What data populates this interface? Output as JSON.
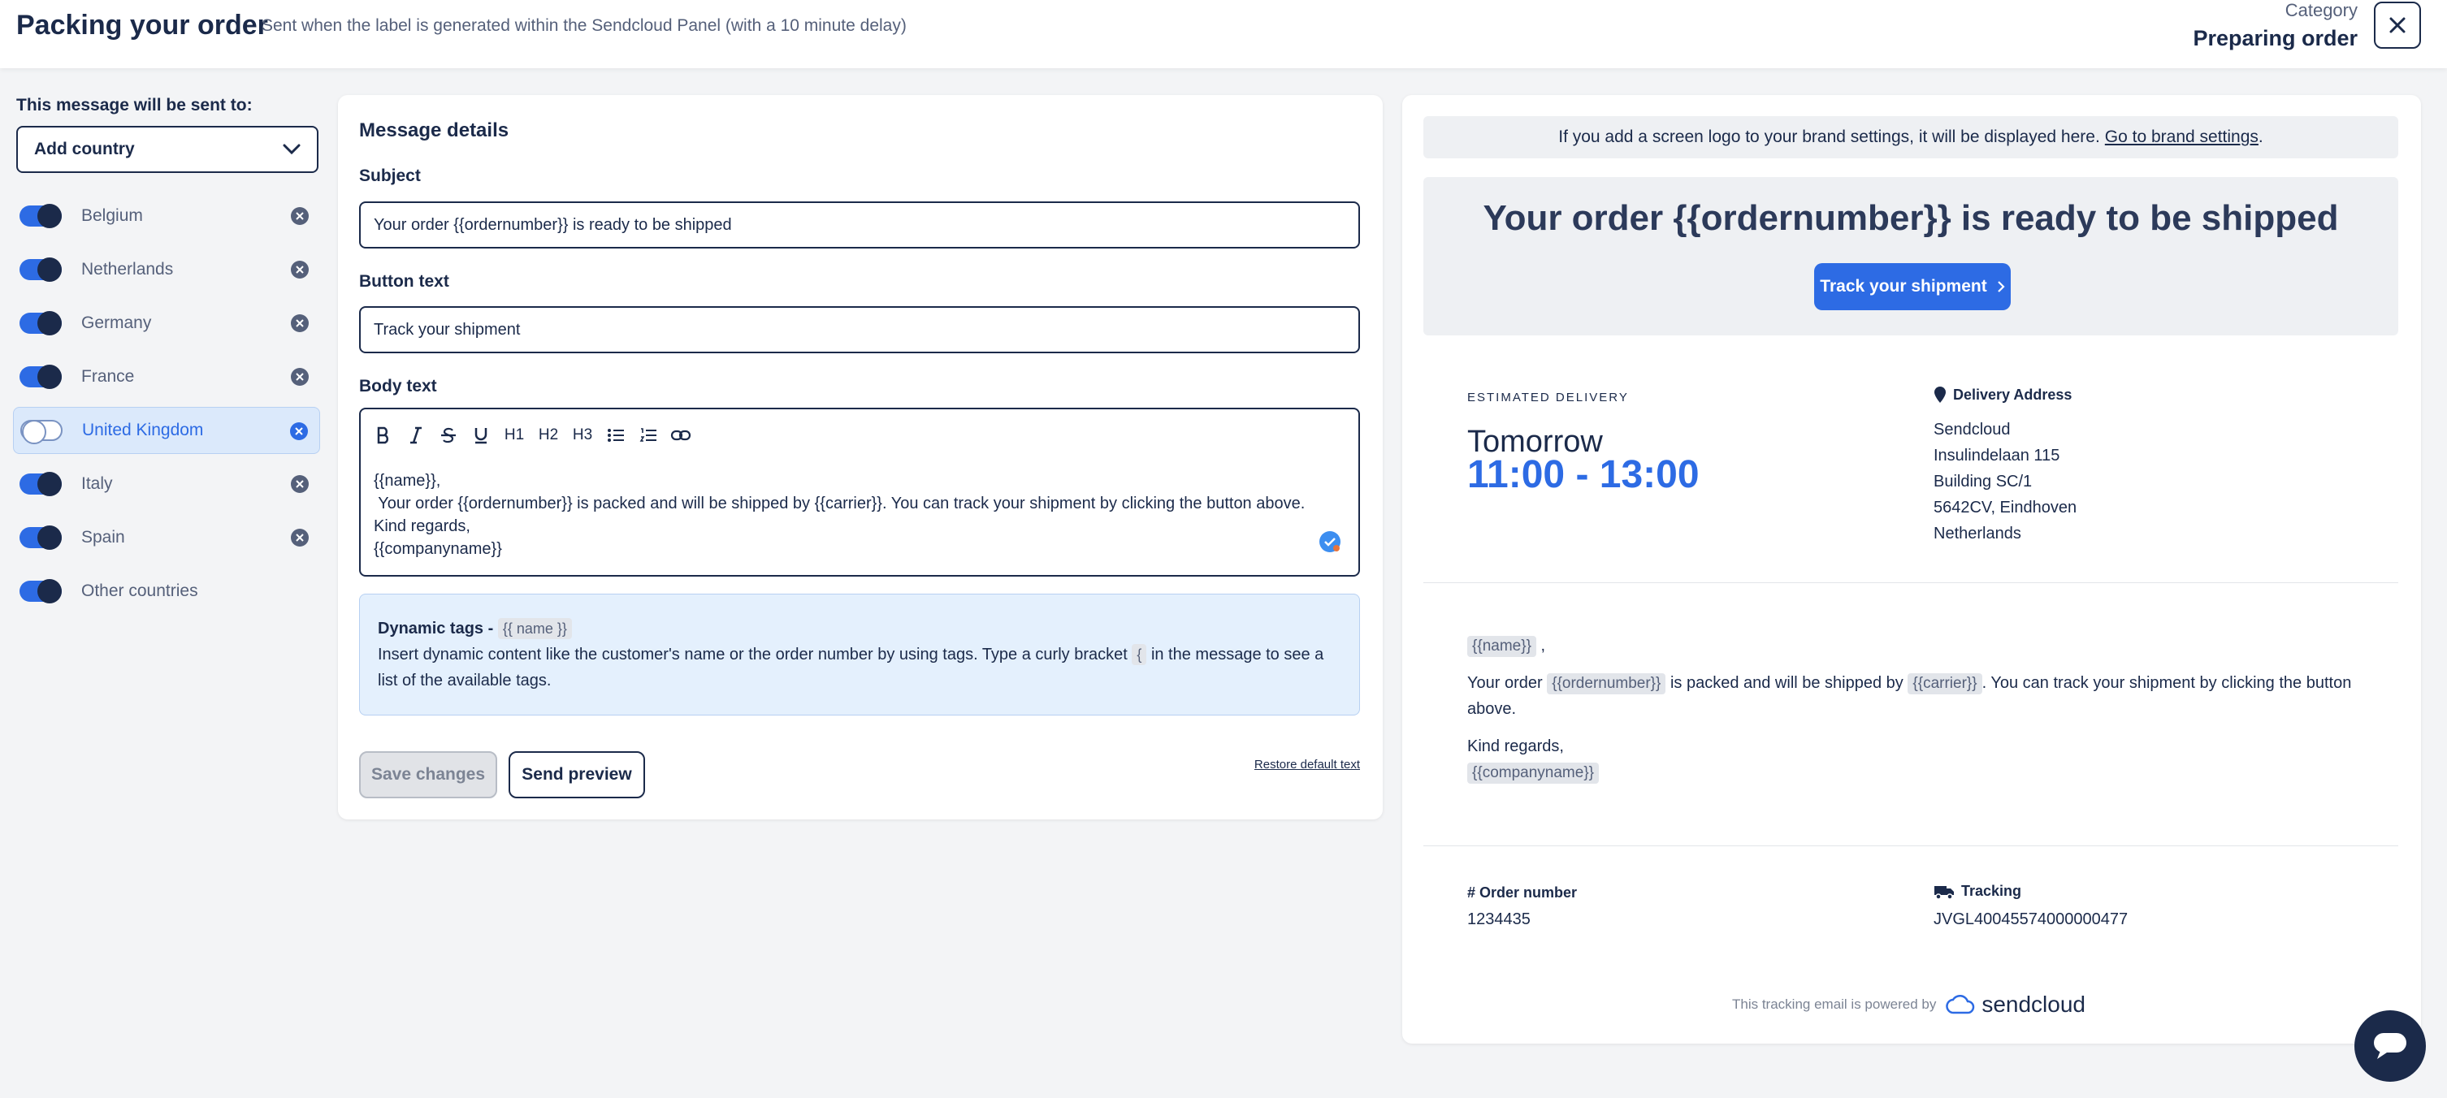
{
  "header": {
    "title": "Packing your order",
    "subtitle": "Sent when the label is generated within the Sendcloud Panel (with a 10 minute delay)",
    "category_label": "Category",
    "category_value": "Preparing order"
  },
  "sidebar": {
    "sent_to_label": "This message will be sent to:",
    "add_country_label": "Add country",
    "countries": [
      {
        "name": "Belgium",
        "enabled": true,
        "removable": true
      },
      {
        "name": "Netherlands",
        "enabled": true,
        "removable": true
      },
      {
        "name": "Germany",
        "enabled": true,
        "removable": true
      },
      {
        "name": "France",
        "enabled": true,
        "removable": true
      },
      {
        "name": "United Kingdom",
        "enabled": false,
        "removable": true,
        "selected": true
      },
      {
        "name": "Italy",
        "enabled": true,
        "removable": true
      },
      {
        "name": "Spain",
        "enabled": true,
        "removable": true
      },
      {
        "name": "Other countries",
        "enabled": true,
        "removable": false
      }
    ]
  },
  "editor": {
    "title": "Message details",
    "subject_label": "Subject",
    "subject_value": "Your order {{ordernumber}} is ready to be shipped",
    "button_text_label": "Button text",
    "button_text_value": "Track your shipment",
    "body_label": "Body text",
    "toolbar": {
      "h1": "H1",
      "h2": "H2",
      "h3": "H3"
    },
    "body_lines": [
      "{{name}},",
      " Your order {{ordernumber}} is packed and will be shipped by {{carrier}}. You can track your shipment by clicking the button above.",
      "Kind regards,",
      "{{companyname}}"
    ],
    "tags": {
      "title": "Dynamic tags -",
      "example_chip": "{{ name }}",
      "text_before": "Insert dynamic content like the customer's name or the order number by using tags. Type a curly bracket",
      "bracket_chip": "{",
      "text_after": "in the message to see a list of the available tags."
    },
    "save_label": "Save changes",
    "preview_label": "Send preview",
    "restore_label": "Restore default text"
  },
  "preview": {
    "logo_note": "If you add a screen logo to your brand settings, it will be displayed here.",
    "logo_link": "Go to brand settings",
    "logo_note_end": ".",
    "hero_title": "Your order {{ordernumber}} is ready to be shipped",
    "hero_button": "Track your shipment",
    "estimated_label": "ESTIMATED DELIVERY",
    "estimated_day": "Tomorrow",
    "estimated_time": "11:00 - 13:00",
    "address_title": "Delivery Address",
    "address_lines": [
      "Sendcloud",
      "Insulindelaan 115",
      "Building SC/1",
      "5642CV, Eindhoven",
      "Netherlands"
    ],
    "message": {
      "name_tag": "{{name}}",
      "name_suffix": ",",
      "p2_a": "Your order",
      "ordernumber_tag": "{{ordernumber}}",
      "p2_b": "is packed and will be shipped by",
      "carrier_tag": "{{carrier}}",
      "p2_c": ". You can track your shipment by clicking the button above.",
      "regards": "Kind regards,",
      "company_tag": "{{companyname}}"
    },
    "order_label": "# Order number",
    "order_value": "1234435",
    "tracking_label": "Tracking",
    "tracking_value": "JVGL40045574000000477",
    "powered_by": "This tracking email is powered by",
    "brand": "sendcloud"
  },
  "colors": {
    "navy": "#1b2a4a",
    "accent": "#2d6be4",
    "info_bg": "#e4f0fd"
  }
}
